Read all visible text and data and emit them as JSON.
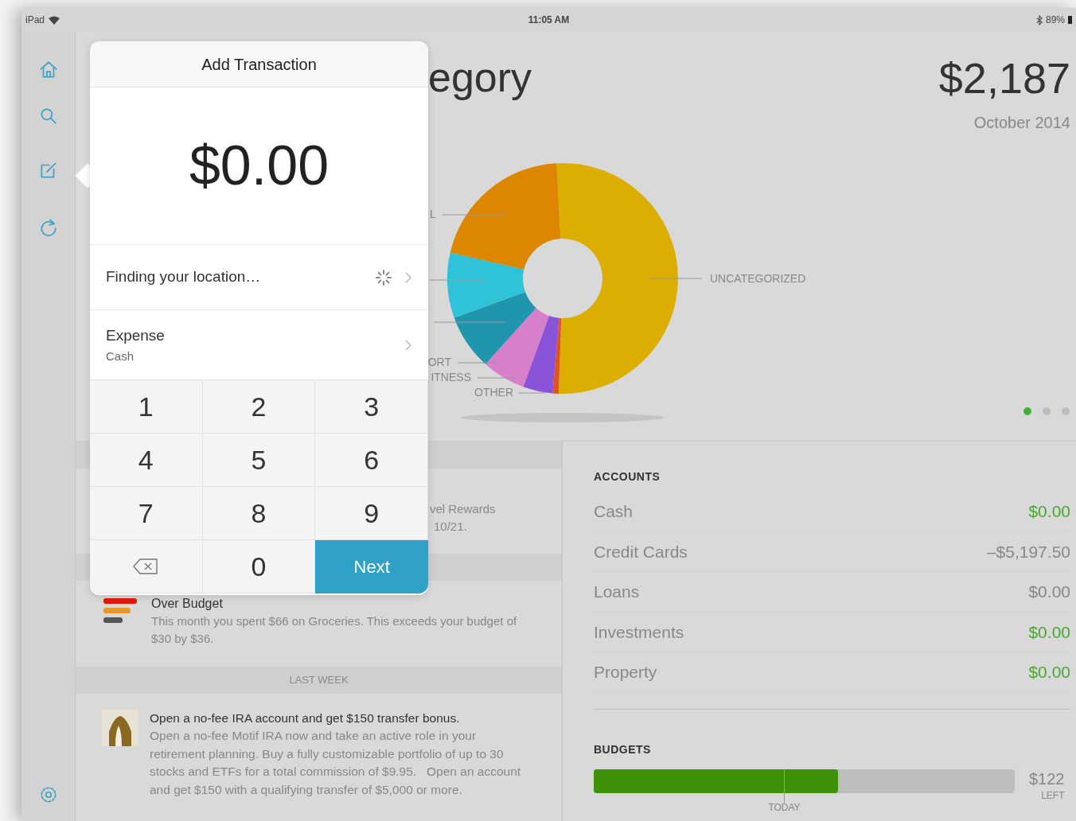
{
  "status_bar": {
    "device": "iPad",
    "time": "11:05 AM",
    "battery": "89%"
  },
  "header": {
    "title": "egory",
    "total": "$2,187",
    "period": "October 2014"
  },
  "chart": {
    "labels": [
      "L",
      "ORT",
      "ITNESS",
      "OTHER",
      "UNCATEGORIZED"
    ]
  },
  "page_dots": [
    {
      "selected": true
    },
    {
      "selected": false
    },
    {
      "selected": false
    }
  ],
  "feed": [
    {
      "kind": "band"
    },
    {
      "kind": "note",
      "lines": [
        "vel Rewards",
        "10/21."
      ]
    },
    {
      "kind": "band"
    },
    {
      "kind": "alert",
      "title": "Over Budget",
      "body": "This month you spent $66 on Groceries. This exceeds your budget of $30 by $36."
    },
    {
      "kind": "header",
      "label": "LAST WEEK"
    },
    {
      "kind": "offer",
      "title": "Open a no-fee IRA account and get $150 transfer bonus.",
      "body": "Open a no-fee Motif IRA now and take an active role in your retirement planning. Buy a fully customizable portfolio of up to 30 stocks and ETFs for a total commission of $9.95.   Open an account and get $150 with a qualifying transfer of $5,000 or more."
    }
  ],
  "accounts": {
    "heading": "ACCOUNTS",
    "rows": [
      {
        "name": "Cash",
        "amount": "$0.00",
        "green": true
      },
      {
        "name": "Credit Cards",
        "amount": "–$5,197.50",
        "green": false
      },
      {
        "name": "Loans",
        "amount": "$0.00",
        "green": false
      },
      {
        "name": "Investments",
        "amount": "$0.00",
        "green": true
      },
      {
        "name": "Property",
        "amount": "$0.00",
        "green": true
      }
    ]
  },
  "budgets": {
    "heading": "BUDGETS",
    "level": 0.58,
    "amount": "$122",
    "note": "LEFT",
    "marker": "TODAY"
  },
  "popover": {
    "title": "Add Transaction",
    "amount": "$0.00",
    "location": "Finding your location…",
    "type": "Expense",
    "account": "Cash",
    "keys": [
      {
        "kind": "digit",
        "label": "1"
      },
      {
        "kind": "digit",
        "label": "2"
      },
      {
        "kind": "digit",
        "label": "3"
      },
      {
        "kind": "digit",
        "label": "4"
      },
      {
        "kind": "digit",
        "label": "5"
      },
      {
        "kind": "digit",
        "label": "6"
      },
      {
        "kind": "digit",
        "label": "7"
      },
      {
        "kind": "digit",
        "label": "8"
      },
      {
        "kind": "digit",
        "label": "9"
      },
      {
        "kind": "delete"
      },
      {
        "kind": "digit",
        "label": "0"
      },
      {
        "kind": "next",
        "label": "Next"
      }
    ]
  }
}
